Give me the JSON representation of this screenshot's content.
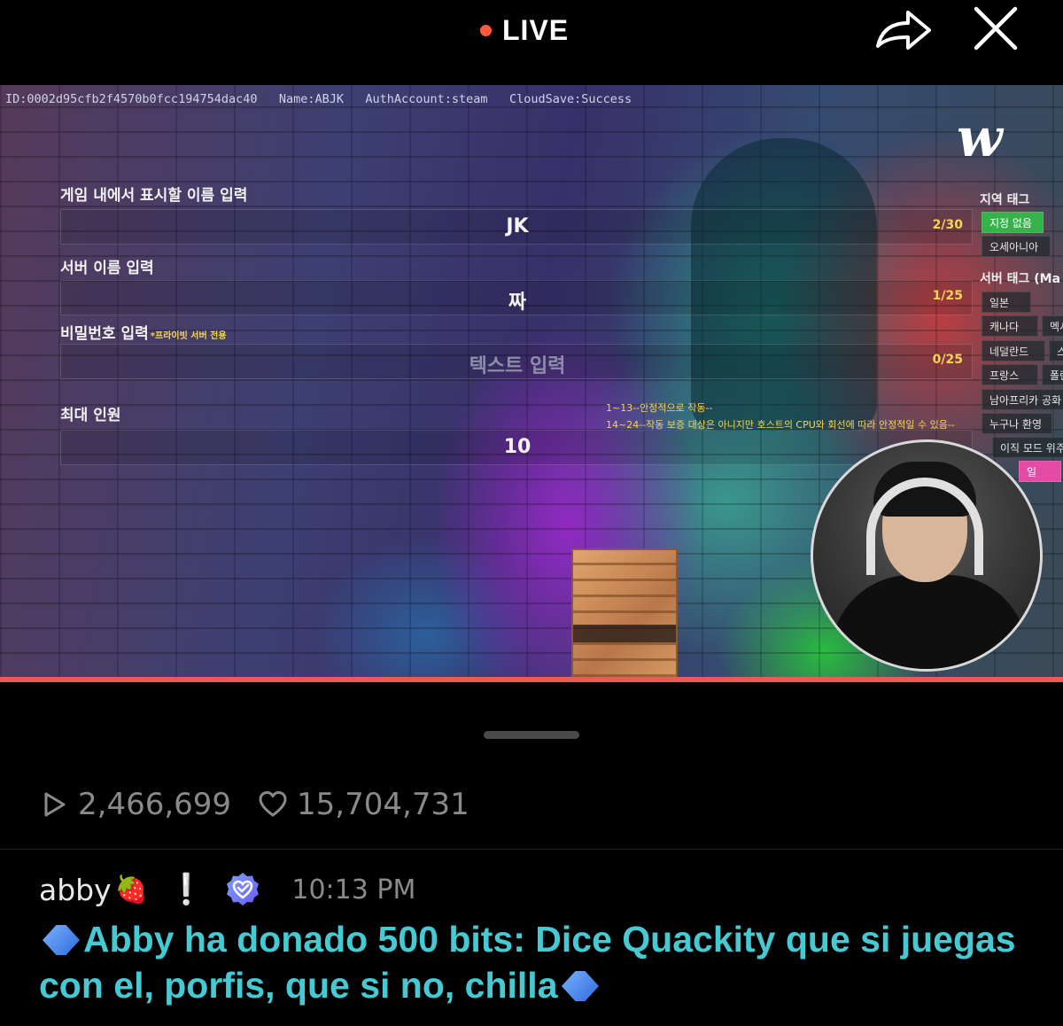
{
  "topbar": {
    "live_label": "LIVE",
    "live_color": "#ff5a3c",
    "share_icon": "share-arrow-icon",
    "close_icon": "close-icon"
  },
  "game": {
    "debug_info": "ID:0002d95cfb2f4570b0fcc194754dac40   Name:ABJK   AuthAccount:steam   CloudSave:Success",
    "fields": [
      {
        "label": "게임 내에서 표시할 이름 입력",
        "value": "JK",
        "count": "2/30"
      },
      {
        "label": "서버 이름 입력",
        "value": "짜",
        "count": "1/25"
      },
      {
        "label": "비밀번호 입력",
        "note": "*프라이빗 서버 전용",
        "placeholder": "텍스트 입력",
        "count": "0/25"
      },
      {
        "label": "최대 인원",
        "value": "10"
      }
    ],
    "notes": [
      "1~13--안정적으로 작동--",
      "14~24--작동 보증 대상은 아니지만 호스트의 CPU와 회선에 따라 안정적일 수 있음--"
    ],
    "logo_text": "w",
    "region_tag_title": "지역 태그",
    "region_tags": [
      "지정 없음",
      "오세아니아"
    ],
    "server_tag_title": "서버 태그 (Ma",
    "server_tags": [
      "일본",
      "캐나다",
      "멕시",
      "네덜란드",
      "스",
      "프랑스",
      "폴란",
      "남아프리카 공화",
      "누구나 환영",
      "이직 모드 위주",
      "일"
    ]
  },
  "stats": {
    "views": "2,466,699",
    "likes": "15,704,731"
  },
  "chat": {
    "username": "abby",
    "username_emoji": "🍓",
    "exclamation": "❕",
    "badge_icon": "verified-heart-badge-icon",
    "time": "10:13 PM",
    "message": "Abby ha donado 500 bits: Dice Quackity que si juegas con el, porfis, que si no, chilla",
    "message_color": "#45c9d3"
  },
  "colors": {
    "progress": "#ec5a55",
    "tag_active": "#35b24a",
    "count_yellow": "#f7d45c"
  }
}
